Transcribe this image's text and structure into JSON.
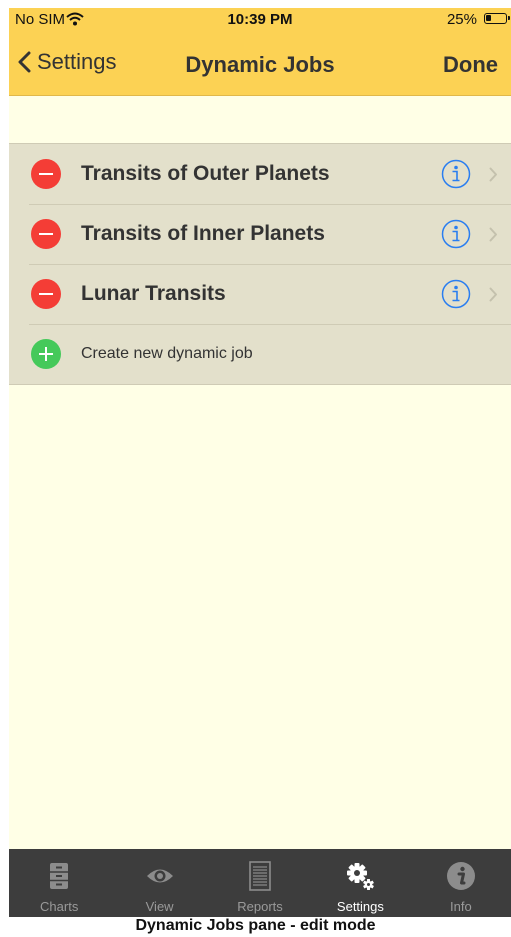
{
  "status_bar": {
    "carrier": "No SIM",
    "time": "10:39 PM",
    "battery": "25%",
    "battery_level": 0.25
  },
  "navbar": {
    "back_label": "Settings",
    "title": "Dynamic Jobs",
    "done_label": "Done"
  },
  "jobs": [
    {
      "label": "Transits of Outer Planets"
    },
    {
      "label": "Transits of Inner Planets"
    },
    {
      "label": "Lunar Transits"
    }
  ],
  "create_label": "Create new dynamic job",
  "tabs": [
    {
      "label": "Charts",
      "icon": "cabinet-icon"
    },
    {
      "label": "View",
      "icon": "eye-icon"
    },
    {
      "label": "Reports",
      "icon": "document-icon"
    },
    {
      "label": "Settings",
      "icon": "gears-icon",
      "active": true
    },
    {
      "label": "Info",
      "icon": "info-icon"
    }
  ],
  "caption": "Dynamic Jobs pane - edit mode",
  "colors": {
    "bar": "#fcd254",
    "background": "#ffffe6",
    "list": "#e3e0cb",
    "delete": "#f43d36",
    "add": "#45c95a",
    "info": "#2a7ef0",
    "tabbar": "#3d3d3d"
  }
}
